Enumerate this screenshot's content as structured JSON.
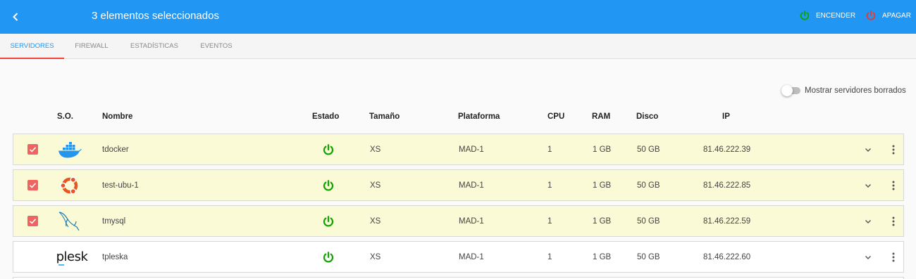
{
  "header": {
    "title": "3 elementos seleccionados",
    "power_on_label": "ENCENDER",
    "power_off_label": "APAGAR",
    "bg_color": "#2196f3",
    "power_on_color": "#11a300",
    "power_off_color": "#e53935"
  },
  "tabs": [
    {
      "label": "SERVIDORES",
      "active": true
    },
    {
      "label": "FIREWALL",
      "active": false
    },
    {
      "label": "ESTADÍSTICAS",
      "active": false
    },
    {
      "label": "EVENTOS",
      "active": false
    }
  ],
  "toggle": {
    "label": "Mostrar servidores borrados",
    "on": false
  },
  "columns": {
    "os": "S.O.",
    "name": "Nombre",
    "status": "Estado",
    "size": "Tamaño",
    "platform": "Plataforma",
    "cpu": "CPU",
    "ram": "RAM",
    "disk": "Disco",
    "ip": "IP"
  },
  "rows": [
    {
      "selected": true,
      "os_icon": "docker-icon",
      "name": "tdocker",
      "status": "power-on",
      "size": "XS",
      "platform": "MAD-1",
      "cpu": "1",
      "ram": "1 GB",
      "disk": "50 GB",
      "ip": "81.46.222.39"
    },
    {
      "selected": true,
      "os_icon": "ubuntu-icon",
      "name": "test-ubu-1",
      "status": "power-on",
      "size": "XS",
      "platform": "MAD-1",
      "cpu": "1",
      "ram": "1 GB",
      "disk": "50 GB",
      "ip": "81.46.222.85"
    },
    {
      "selected": true,
      "os_icon": "mysql-icon",
      "name": "tmysql",
      "status": "power-on",
      "size": "XS",
      "platform": "MAD-1",
      "cpu": "1",
      "ram": "1 GB",
      "disk": "50 GB",
      "ip": "81.46.222.59"
    },
    {
      "selected": false,
      "os_icon": "plesk-logo",
      "os_text": "plesk",
      "name": "tpleska",
      "status": "power-on",
      "size": "XS",
      "platform": "MAD-1",
      "cpu": "1",
      "ram": "1 GB",
      "disk": "50 GB",
      "ip": "81.46.222.60"
    }
  ],
  "colors": {
    "accent": "#2196f3",
    "selected_row": "#fafad7",
    "checkbox": "#ef6461",
    "status_on": "#11a300"
  }
}
